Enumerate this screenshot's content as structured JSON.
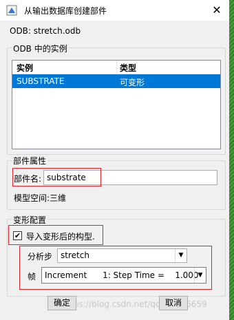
{
  "window": {
    "title": "从输出数据库创建部件",
    "close_glyph": "✕"
  },
  "odb": {
    "label": "ODB: stretch.odb"
  },
  "instances": {
    "group_title": "ODB 中的实例",
    "columns": [
      "实例",
      "类型"
    ],
    "rows": [
      {
        "instance": "SUBSTRATE",
        "type": "可变形",
        "selected": true
      }
    ]
  },
  "part_props": {
    "group_title": "部件属性",
    "name_label": "部件名:",
    "name_value": "substrate",
    "model_space": "模型空间:三维"
  },
  "deformed": {
    "group_title": "变形配置",
    "import_label": "导入变形后的构型.",
    "import_checked": true,
    "step_label": "分析步",
    "step_value": "stretch",
    "frame_label": "帧",
    "frame_value": "Increment      1: Step Time =    1.000"
  },
  "buttons": {
    "ok": "确定",
    "cancel": "取消"
  },
  "watermark": "https://blog.csdn.net/qq_39486659",
  "colors": {
    "selection": "#0078d7",
    "annotation_red": "#e0222b"
  }
}
